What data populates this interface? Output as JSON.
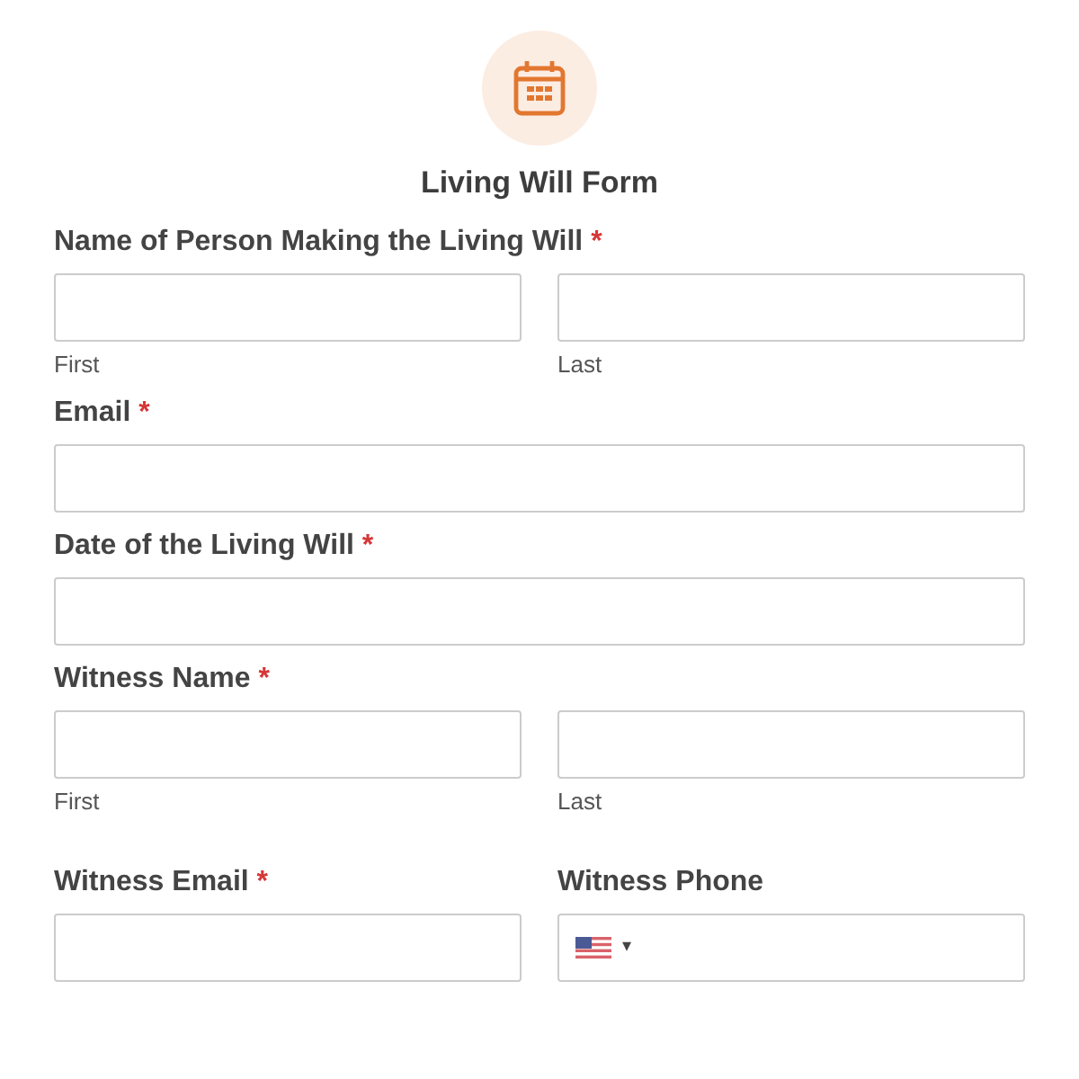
{
  "form": {
    "title": "Living Will Form"
  },
  "sections": [
    {
      "kind": "split",
      "label": "Name of Person Making the Living Will",
      "required_mark": "*",
      "sublabels": [
        "First",
        "Last"
      ]
    },
    {
      "kind": "single",
      "label": "Email",
      "required_mark": "*"
    },
    {
      "kind": "single",
      "label": "Date of the Living Will",
      "required_mark": "*"
    },
    {
      "kind": "split",
      "label": "Witness Name",
      "required_mark": "*",
      "sublabels": [
        "First",
        "Last"
      ]
    },
    {
      "kind": "pair",
      "fields": [
        {
          "kind": "text",
          "label": "Witness Email",
          "required_mark": "*"
        },
        {
          "kind": "phone",
          "label": "Witness Phone",
          "country_caret": "▾"
        }
      ]
    }
  ]
}
